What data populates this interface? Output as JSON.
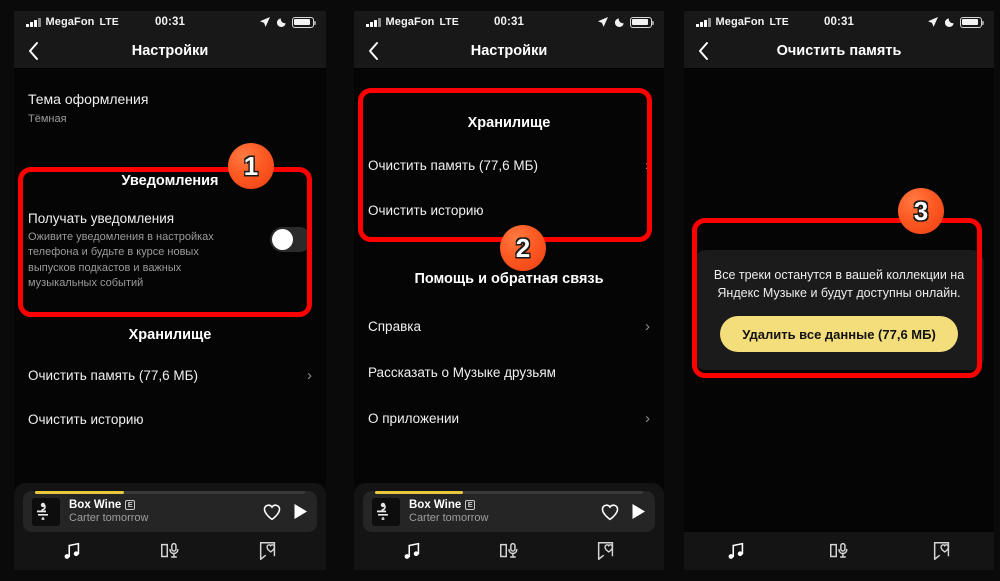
{
  "statusbar": {
    "carrier": "MegaFon",
    "network": "LTE",
    "time": "00:31",
    "icons": [
      "signal-bars-icon",
      "location-arrow-icon",
      "moon-icon",
      "battery-icon"
    ]
  },
  "panel1": {
    "nav": {
      "title": "Настройки",
      "back_icon": "chevron-left-icon"
    },
    "theme": {
      "label": "Тема оформления",
      "value": "Тёмная"
    },
    "notifications": {
      "section_title": "Уведомления",
      "row_label": "Получать уведомления",
      "row_description": "Оживите уведомления в настройках телефона и будьте в курсе новых выпусков подкастов и важных музыкальных событий",
      "toggle_state": "off"
    },
    "storage": {
      "section_title": "Хранилище",
      "items": [
        {
          "label": "Очистить память (77,6 МБ)",
          "chevron": true
        },
        {
          "label": "Очистить историю",
          "chevron": false
        }
      ]
    },
    "badge": "1"
  },
  "panel2": {
    "nav": {
      "title": "Настройки",
      "back_icon": "chevron-left-icon"
    },
    "storage": {
      "section_title": "Хранилище",
      "items": [
        {
          "label": "Очистить память (77,6 МБ)",
          "chevron": true
        },
        {
          "label": "Очистить историю",
          "chevron": false
        }
      ]
    },
    "help": {
      "section_title": "Помощь и обратная связь",
      "items": [
        {
          "label": "Справка",
          "chevron": true
        },
        {
          "label": "Рассказать о Музыке друзьям",
          "chevron": false
        },
        {
          "label": "О приложении",
          "chevron": true
        }
      ]
    },
    "badge": "2"
  },
  "panel3": {
    "nav": {
      "title": "Очистить память",
      "back_icon": "chevron-left-icon"
    },
    "dialog": {
      "text": "Все треки останутся в вашей коллекции на Яндекс Музыке и будут доступны онлайн.",
      "button_label": "Удалить все данные (77,6 МБ)"
    },
    "badge": "3"
  },
  "player": {
    "title": "Box Wine",
    "explicit_mark": "E",
    "artist": "Carter tomorrow",
    "progress_percent": 33,
    "like_icon": "heart-icon",
    "play_icon": "play-icon",
    "progress_color": "#E8C93B"
  },
  "tabbar": {
    "tabs": [
      {
        "name": "tab-music",
        "icon": "music-note-icon"
      },
      {
        "name": "tab-podcasts",
        "icon": "book-mic-icon"
      },
      {
        "name": "tab-library",
        "icon": "bookmark-heart-icon"
      }
    ]
  },
  "colors": {
    "highlight": "#FF0000",
    "badge": "#FC5A22",
    "accent_button": "#F4DE7B",
    "background": "#050505"
  }
}
